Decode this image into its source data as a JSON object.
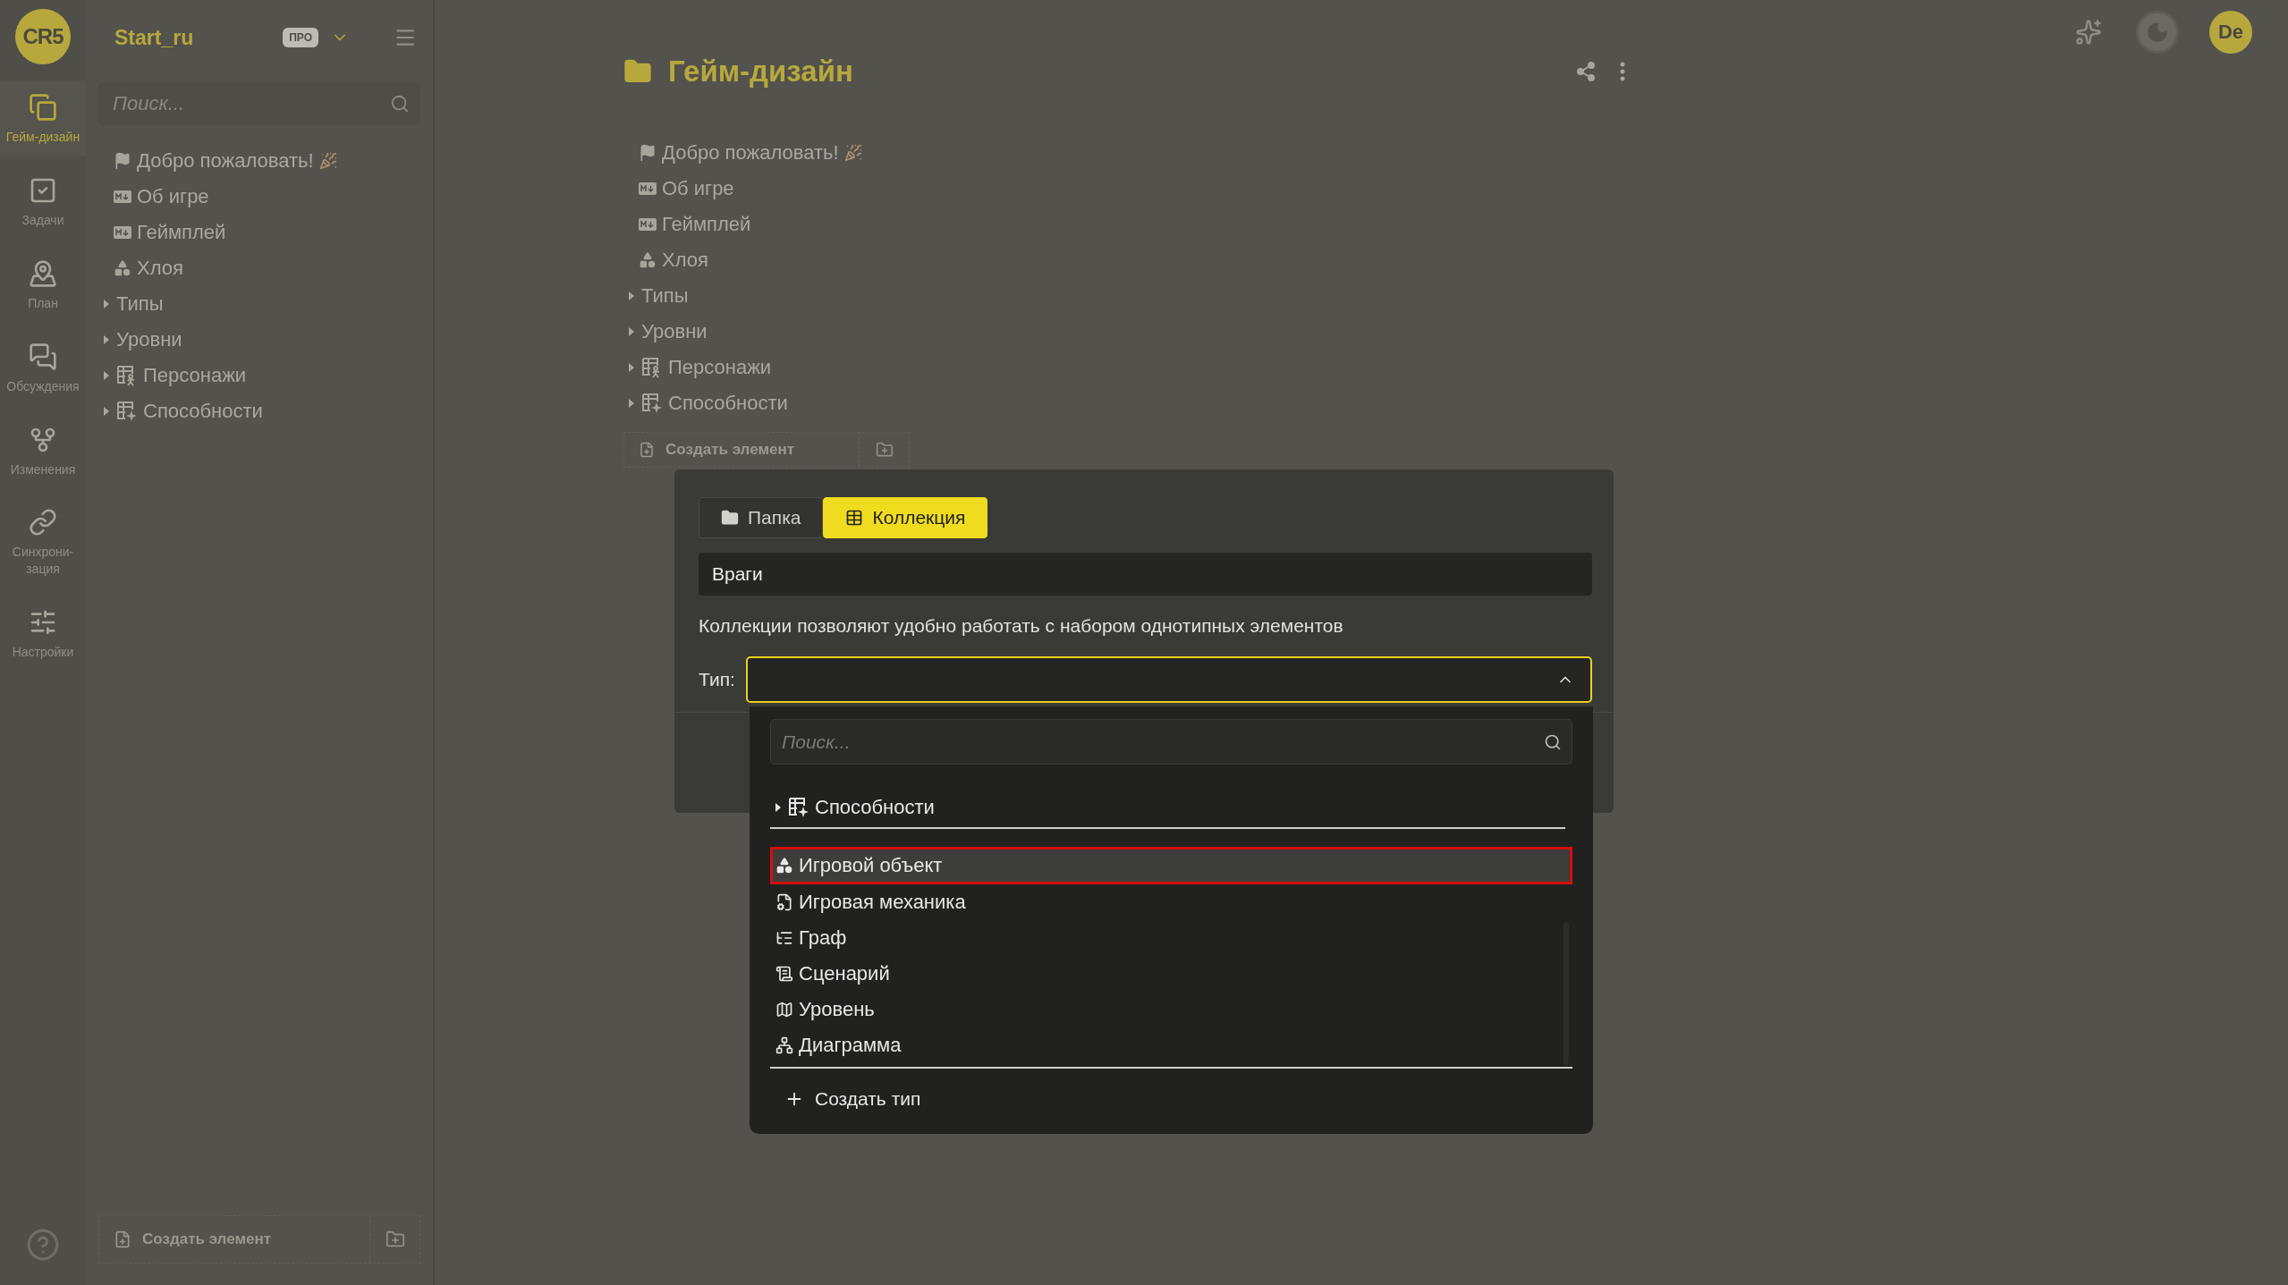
{
  "rail": {
    "logo": "CR5",
    "items": [
      {
        "label": "Гейм-дизайн",
        "selected": true
      },
      {
        "label": "Задачи",
        "selected": false
      },
      {
        "label": "План",
        "selected": false
      },
      {
        "label": "Обсуждения",
        "selected": false
      },
      {
        "label": "Изменения",
        "selected": false
      },
      {
        "label": "Синхрони-зация",
        "selected": false
      },
      {
        "label": "Настройки",
        "selected": false
      }
    ]
  },
  "sidebar": {
    "project": "Start_ru",
    "badge": "ПРО",
    "search": {
      "placeholder": "Поиск..."
    },
    "tree": [
      {
        "label": "Добро пожаловать!",
        "kind": "welcome"
      },
      {
        "label": "Об игре",
        "kind": "markdown"
      },
      {
        "label": "Геймплей",
        "kind": "markdown"
      },
      {
        "label": "Хлоя",
        "kind": "game-object"
      },
      {
        "label": "Типы",
        "kind": "folder",
        "expanded": false
      },
      {
        "label": "Уровни",
        "kind": "folder",
        "expanded": false
      },
      {
        "label": "Персонажи",
        "kind": "character-collection",
        "expanded": false
      },
      {
        "label": "Способности",
        "kind": "ability-collection",
        "expanded": false
      }
    ],
    "create_button": "Создать элемент"
  },
  "top_bar": {
    "avatar": "De"
  },
  "main": {
    "title": "Гейм-дизайн",
    "tree": [
      {
        "label": "Добро пожаловать!",
        "kind": "welcome"
      },
      {
        "label": "Об игре",
        "kind": "markdown"
      },
      {
        "label": "Геймплей",
        "kind": "markdown"
      },
      {
        "label": "Хлоя",
        "kind": "game-object"
      },
      {
        "label": "Типы",
        "kind": "folder",
        "expanded": false
      },
      {
        "label": "Уровни",
        "kind": "folder",
        "expanded": false
      },
      {
        "label": "Персонажи",
        "kind": "character-collection",
        "expanded": false
      },
      {
        "label": "Способности",
        "kind": "ability-collection",
        "expanded": false
      }
    ],
    "create_button": "Создать элемент"
  },
  "dialog": {
    "tabs": [
      {
        "label": "Папка",
        "selected": false
      },
      {
        "label": "Коллекция",
        "selected": true
      }
    ],
    "name": {
      "value": "Враги"
    },
    "description": "Коллекции позволяют удобно работать с набором однотипных элементов",
    "type_label": "Тип:",
    "type_select": {
      "expanded": true
    },
    "dropdown": {
      "search": {
        "placeholder": "Поиск..."
      },
      "tree": [
        {
          "label": "Способности",
          "kind": "ability-collection",
          "expanded": false
        }
      ],
      "types": [
        {
          "label": "Игровой объект",
          "kind": "game-object",
          "selected": true
        },
        {
          "label": "Игровая механика",
          "kind": "mechanic",
          "selected": false
        },
        {
          "label": "Граф",
          "kind": "graph",
          "selected": false
        },
        {
          "label": "Сценарий",
          "kind": "scenario",
          "selected": false
        },
        {
          "label": "Уровень",
          "kind": "level",
          "selected": false
        },
        {
          "label": "Диаграмма",
          "kind": "diagram",
          "selected": false
        }
      ],
      "create_button": "Создать тип"
    }
  }
}
